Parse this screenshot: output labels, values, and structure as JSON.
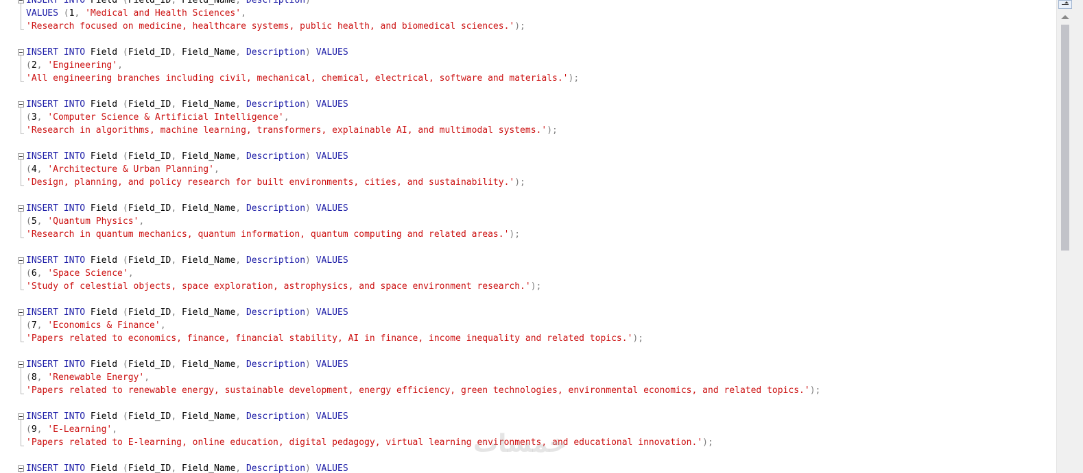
{
  "editor": {
    "lines": [
      {
        "type": "first",
        "segs": [
          [
            "kw",
            "INSERT INTO"
          ],
          [
            "plain",
            " Field "
          ],
          [
            "punc",
            "("
          ],
          [
            "plain",
            "Field_ID"
          ],
          [
            "punc",
            ", "
          ],
          [
            "plain",
            "Field_Name"
          ],
          [
            "punc",
            ", "
          ],
          [
            "kw",
            "Description"
          ],
          [
            "punc",
            ")"
          ]
        ]
      },
      {
        "type": "cont",
        "segs": [
          [
            "kw",
            "VALUES"
          ],
          [
            "punc",
            " ("
          ],
          [
            "plain",
            "1"
          ],
          [
            "punc",
            ", "
          ],
          [
            "str",
            "'Medical and Health Sciences'"
          ],
          [
            "punc",
            ","
          ]
        ]
      },
      {
        "type": "last",
        "segs": [
          [
            "str",
            "'Research focused on medicine, healthcare systems, public health, and biomedical sciences.'"
          ],
          [
            "punc",
            ");"
          ]
        ]
      },
      {
        "type": "blank",
        "segs": []
      },
      {
        "type": "first",
        "segs": [
          [
            "kw",
            "INSERT INTO"
          ],
          [
            "plain",
            " Field "
          ],
          [
            "punc",
            "("
          ],
          [
            "plain",
            "Field_ID"
          ],
          [
            "punc",
            ", "
          ],
          [
            "plain",
            "Field_Name"
          ],
          [
            "punc",
            ", "
          ],
          [
            "kw",
            "Description"
          ],
          [
            "punc",
            ") "
          ],
          [
            "kw",
            "VALUES"
          ]
        ]
      },
      {
        "type": "cont",
        "segs": [
          [
            "punc",
            "("
          ],
          [
            "plain",
            "2"
          ],
          [
            "punc",
            ", "
          ],
          [
            "str",
            "'Engineering'"
          ],
          [
            "punc",
            ","
          ]
        ]
      },
      {
        "type": "last",
        "segs": [
          [
            "str",
            "'All engineering branches including civil, mechanical, chemical, electrical, software and materials.'"
          ],
          [
            "punc",
            ");"
          ]
        ]
      },
      {
        "type": "blank",
        "segs": []
      },
      {
        "type": "first",
        "segs": [
          [
            "kw",
            "INSERT INTO"
          ],
          [
            "plain",
            " Field "
          ],
          [
            "punc",
            "("
          ],
          [
            "plain",
            "Field_ID"
          ],
          [
            "punc",
            ", "
          ],
          [
            "plain",
            "Field_Name"
          ],
          [
            "punc",
            ", "
          ],
          [
            "kw",
            "Description"
          ],
          [
            "punc",
            ") "
          ],
          [
            "kw",
            "VALUES"
          ]
        ]
      },
      {
        "type": "cont",
        "segs": [
          [
            "punc",
            "("
          ],
          [
            "plain",
            "3"
          ],
          [
            "punc",
            ", "
          ],
          [
            "str",
            "'Computer Science & Artificial Intelligence'"
          ],
          [
            "punc",
            ","
          ]
        ]
      },
      {
        "type": "last",
        "segs": [
          [
            "str",
            "'Research in algorithms, machine learning, transformers, explainable AI, and multimodal systems.'"
          ],
          [
            "punc",
            ");"
          ]
        ]
      },
      {
        "type": "blank",
        "segs": []
      },
      {
        "type": "first",
        "segs": [
          [
            "kw",
            "INSERT INTO"
          ],
          [
            "plain",
            " Field "
          ],
          [
            "punc",
            "("
          ],
          [
            "plain",
            "Field_ID"
          ],
          [
            "punc",
            ", "
          ],
          [
            "plain",
            "Field_Name"
          ],
          [
            "punc",
            ", "
          ],
          [
            "kw",
            "Description"
          ],
          [
            "punc",
            ") "
          ],
          [
            "kw",
            "VALUES"
          ]
        ]
      },
      {
        "type": "cont",
        "segs": [
          [
            "punc",
            "("
          ],
          [
            "plain",
            "4"
          ],
          [
            "punc",
            ", "
          ],
          [
            "str",
            "'Architecture & Urban Planning'"
          ],
          [
            "punc",
            ","
          ]
        ]
      },
      {
        "type": "last",
        "segs": [
          [
            "str",
            "'Design, planning, and policy research for built environments, cities, and sustainability.'"
          ],
          [
            "punc",
            ");"
          ]
        ]
      },
      {
        "type": "blank",
        "segs": []
      },
      {
        "type": "first",
        "segs": [
          [
            "kw",
            "INSERT INTO"
          ],
          [
            "plain",
            " Field "
          ],
          [
            "punc",
            "("
          ],
          [
            "plain",
            "Field_ID"
          ],
          [
            "punc",
            ", "
          ],
          [
            "plain",
            "Field_Name"
          ],
          [
            "punc",
            ", "
          ],
          [
            "kw",
            "Description"
          ],
          [
            "punc",
            ") "
          ],
          [
            "kw",
            "VALUES"
          ]
        ]
      },
      {
        "type": "cont",
        "segs": [
          [
            "punc",
            "("
          ],
          [
            "plain",
            "5"
          ],
          [
            "punc",
            ", "
          ],
          [
            "str",
            "'Quantum Physics'"
          ],
          [
            "punc",
            ","
          ]
        ]
      },
      {
        "type": "last",
        "segs": [
          [
            "str",
            "'Research in quantum mechanics, quantum information, quantum computing and related areas.'"
          ],
          [
            "punc",
            ");"
          ]
        ]
      },
      {
        "type": "blank",
        "segs": []
      },
      {
        "type": "first",
        "segs": [
          [
            "kw",
            "INSERT INTO"
          ],
          [
            "plain",
            " Field "
          ],
          [
            "punc",
            "("
          ],
          [
            "plain",
            "Field_ID"
          ],
          [
            "punc",
            ", "
          ],
          [
            "plain",
            "Field_Name"
          ],
          [
            "punc",
            ", "
          ],
          [
            "kw",
            "Description"
          ],
          [
            "punc",
            ") "
          ],
          [
            "kw",
            "VALUES"
          ]
        ]
      },
      {
        "type": "cont",
        "segs": [
          [
            "punc",
            "("
          ],
          [
            "plain",
            "6"
          ],
          [
            "punc",
            ", "
          ],
          [
            "str",
            "'Space Science'"
          ],
          [
            "punc",
            ","
          ]
        ]
      },
      {
        "type": "last",
        "segs": [
          [
            "str",
            "'Study of celestial objects, space exploration, astrophysics, and space environment research.'"
          ],
          [
            "punc",
            ");"
          ]
        ]
      },
      {
        "type": "blank",
        "segs": []
      },
      {
        "type": "first",
        "segs": [
          [
            "kw",
            "INSERT INTO"
          ],
          [
            "plain",
            " Field "
          ],
          [
            "punc",
            "("
          ],
          [
            "plain",
            "Field_ID"
          ],
          [
            "punc",
            ", "
          ],
          [
            "plain",
            "Field_Name"
          ],
          [
            "punc",
            ", "
          ],
          [
            "kw",
            "Description"
          ],
          [
            "punc",
            ") "
          ],
          [
            "kw",
            "VALUES"
          ]
        ]
      },
      {
        "type": "cont",
        "segs": [
          [
            "punc",
            "("
          ],
          [
            "plain",
            "7"
          ],
          [
            "punc",
            ", "
          ],
          [
            "str",
            "'Economics & Finance'"
          ],
          [
            "punc",
            ","
          ]
        ]
      },
      {
        "type": "last",
        "segs": [
          [
            "str",
            "'Papers related to economics, finance, financial stability, AI in finance, income inequality and related topics.'"
          ],
          [
            "punc",
            ");"
          ]
        ]
      },
      {
        "type": "blank",
        "segs": []
      },
      {
        "type": "first",
        "segs": [
          [
            "kw",
            "INSERT INTO"
          ],
          [
            "plain",
            " Field "
          ],
          [
            "punc",
            "("
          ],
          [
            "plain",
            "Field_ID"
          ],
          [
            "punc",
            ", "
          ],
          [
            "plain",
            "Field_Name"
          ],
          [
            "punc",
            ", "
          ],
          [
            "kw",
            "Description"
          ],
          [
            "punc",
            ") "
          ],
          [
            "kw",
            "VALUES"
          ]
        ]
      },
      {
        "type": "cont",
        "segs": [
          [
            "punc",
            "("
          ],
          [
            "plain",
            "8"
          ],
          [
            "punc",
            ", "
          ],
          [
            "str",
            "'Renewable Energy'"
          ],
          [
            "punc",
            ","
          ]
        ]
      },
      {
        "type": "last",
        "segs": [
          [
            "str",
            "'Papers related to renewable energy, sustainable development, energy efficiency, green technologies, environmental economics, and related topics.'"
          ],
          [
            "punc",
            ");"
          ]
        ]
      },
      {
        "type": "blank",
        "segs": []
      },
      {
        "type": "first",
        "segs": [
          [
            "kw",
            "INSERT INTO"
          ],
          [
            "plain",
            " Field "
          ],
          [
            "punc",
            "("
          ],
          [
            "plain",
            "Field_ID"
          ],
          [
            "punc",
            ", "
          ],
          [
            "plain",
            "Field_Name"
          ],
          [
            "punc",
            ", "
          ],
          [
            "kw",
            "Description"
          ],
          [
            "punc",
            ") "
          ],
          [
            "kw",
            "VALUES"
          ]
        ]
      },
      {
        "type": "cont",
        "segs": [
          [
            "punc",
            "("
          ],
          [
            "plain",
            "9"
          ],
          [
            "punc",
            ", "
          ],
          [
            "str",
            "'E-Learning'"
          ],
          [
            "punc",
            ","
          ]
        ]
      },
      {
        "type": "last",
        "segs": [
          [
            "str",
            "'Papers related to E-learning, online education, digital pedagogy, virtual learning environments, and educational innovation.'"
          ],
          [
            "punc",
            ");"
          ]
        ]
      },
      {
        "type": "blank",
        "segs": []
      },
      {
        "type": "first",
        "segs": [
          [
            "kw",
            "INSERT INTO"
          ],
          [
            "plain",
            " Field "
          ],
          [
            "punc",
            "("
          ],
          [
            "plain",
            "Field_ID"
          ],
          [
            "punc",
            ", "
          ],
          [
            "plain",
            "Field_Name"
          ],
          [
            "punc",
            ", "
          ],
          [
            "kw",
            "Description"
          ],
          [
            "punc",
            ") "
          ],
          [
            "kw",
            "VALUES"
          ]
        ]
      }
    ]
  },
  "watermark": {
    "text": "خمسات"
  },
  "icons": {
    "split": "split-window-icon",
    "scroll_up": "scroll-up-icon"
  },
  "colors": {
    "keyword": "#1a1aa6",
    "string": "#cc1111",
    "punctuation": "#808080",
    "text": "#000000"
  }
}
